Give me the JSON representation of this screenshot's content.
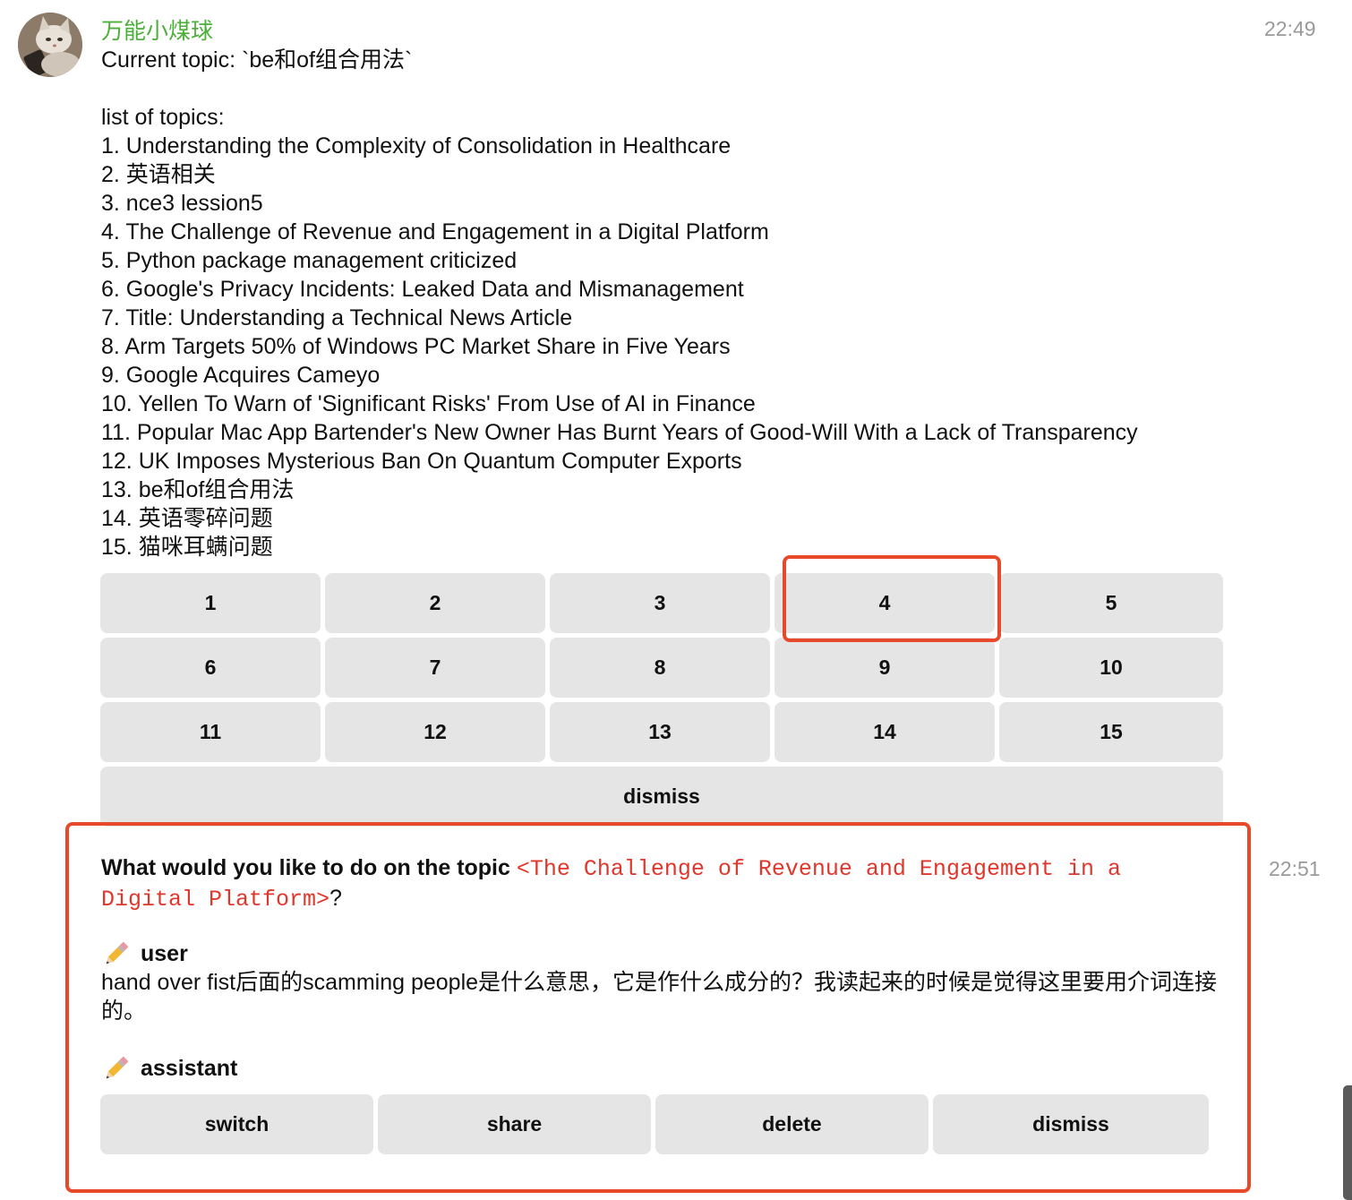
{
  "message1": {
    "sender": "万能小煤球",
    "time": "22:49",
    "current_topic": "Current topic: `be和of组合用法`",
    "list_header": "list of topics:",
    "topics": [
      "1. Understanding the Complexity of Consolidation in Healthcare",
      "2. 英语相关",
      "3. nce3 lession5",
      "4. The Challenge of Revenue and Engagement in a Digital Platform",
      "5. Python package management criticized",
      "6. Google's Privacy Incidents: Leaked Data and Mismanagement",
      "7. Title: Understanding a Technical News Article",
      "8. Arm Targets 50% of Windows PC Market Share in Five Years",
      "9. Google Acquires Cameyo",
      "10. Yellen To Warn of 'Significant Risks' From Use of AI in Finance",
      "11. Popular Mac App Bartender's New Owner Has Burnt Years of Good-Will With a Lack of Transparency",
      "12. UK Imposes Mysterious Ban On Quantum Computer Exports",
      "13. be和of组合用法",
      "14. 英语零碎问题",
      "15. 猫咪耳螨问题"
    ],
    "keyboard": {
      "numbers": [
        "1",
        "2",
        "3",
        "4",
        "5",
        "6",
        "7",
        "8",
        "9",
        "10",
        "11",
        "12",
        "13",
        "14",
        "15"
      ],
      "dismiss": "dismiss"
    }
  },
  "message2": {
    "time": "22:51",
    "question_prefix": "What would you like to do on the topic ",
    "topic_code": "<The Challenge of Revenue and Engagement in a Digital Platform>",
    "question_suffix": "?",
    "user_role": "user",
    "user_text": "hand over fist后面的scamming people是什么意思，它是作什么成分的？我读起来的时候是觉得这里要用介词连接的。",
    "assistant_role": "assistant",
    "buttons": {
      "switch": "switch",
      "share": "share",
      "delete": "delete",
      "dismiss": "dismiss"
    }
  },
  "colors": {
    "sender_name": "#4caf3a",
    "highlight": "#e8492a",
    "code_text": "#e0362b",
    "button_bg": "#e5e5e5"
  }
}
